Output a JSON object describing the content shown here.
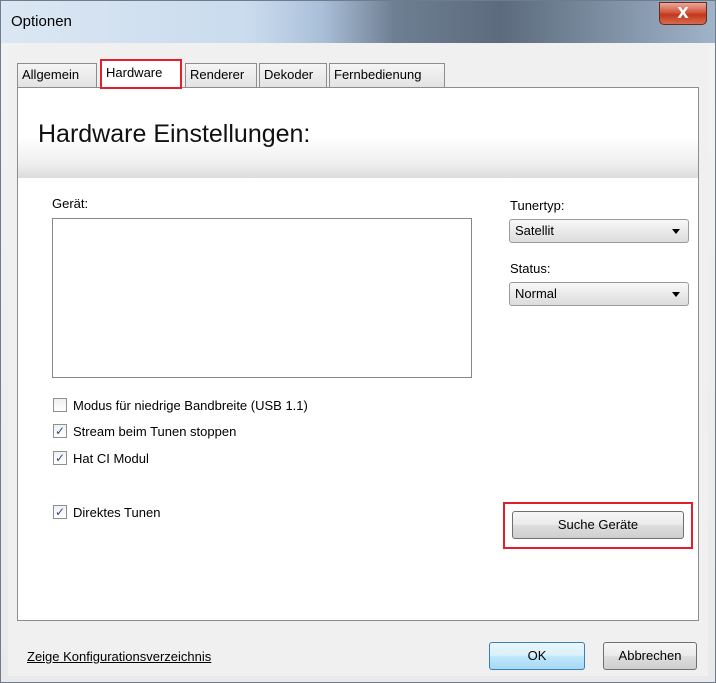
{
  "window": {
    "title": "Optionen",
    "close_glyph": "X"
  },
  "tabs": [
    {
      "label": "Allgemein",
      "active": false
    },
    {
      "label": "Hardware",
      "active": true
    },
    {
      "label": "Renderer",
      "active": false
    },
    {
      "label": "Dekoder",
      "active": false
    },
    {
      "label": "Fernbedienung",
      "active": false
    }
  ],
  "panel": {
    "title": "Hardware Einstellungen:",
    "device_label": "Gerät:",
    "tunertype_label": "Tunertyp:",
    "tunertype_value": "Satellit",
    "status_label": "Status:",
    "status_value": "Normal",
    "checkboxes": [
      {
        "label": "Modus für niedrige Bandbreite (USB 1.1)",
        "checked": false
      },
      {
        "label": "Stream beim Tunen stoppen",
        "checked": true
      },
      {
        "label": "Hat CI Modul",
        "checked": true
      },
      {
        "label": "Direktes Tunen",
        "checked": true
      }
    ],
    "search_button": "Suche Geräte"
  },
  "footer": {
    "config_link": "Zeige Konfigurationsverzeichnis",
    "ok_label": "OK",
    "cancel_label": "Abbrechen"
  },
  "colors": {
    "highlight": "#e0202a",
    "check": "#2b4f86"
  }
}
